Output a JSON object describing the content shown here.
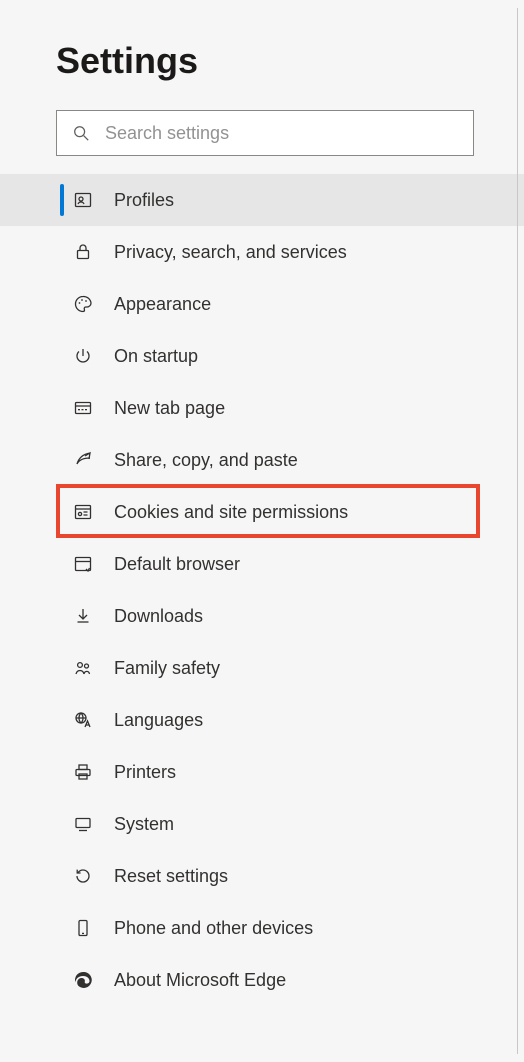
{
  "page_title": "Settings",
  "search": {
    "placeholder": "Search settings"
  },
  "nav": {
    "items": [
      {
        "id": "profiles",
        "label": "Profiles",
        "icon": "profile-card-icon",
        "selected": true
      },
      {
        "id": "privacy",
        "label": "Privacy, search, and services",
        "icon": "lock-icon",
        "selected": false
      },
      {
        "id": "appearance",
        "label": "Appearance",
        "icon": "palette-icon",
        "selected": false
      },
      {
        "id": "startup",
        "label": "On startup",
        "icon": "power-icon",
        "selected": false
      },
      {
        "id": "newtab",
        "label": "New tab page",
        "icon": "new-tab-icon",
        "selected": false
      },
      {
        "id": "share",
        "label": "Share, copy, and paste",
        "icon": "share-icon",
        "selected": false
      },
      {
        "id": "cookies",
        "label": "Cookies and site permissions",
        "icon": "site-permissions-icon",
        "selected": false,
        "highlighted": true
      },
      {
        "id": "default",
        "label": "Default browser",
        "icon": "browser-icon",
        "selected": false
      },
      {
        "id": "downloads",
        "label": "Downloads",
        "icon": "download-icon",
        "selected": false
      },
      {
        "id": "family",
        "label": "Family safety",
        "icon": "family-icon",
        "selected": false
      },
      {
        "id": "languages",
        "label": "Languages",
        "icon": "languages-icon",
        "selected": false
      },
      {
        "id": "printers",
        "label": "Printers",
        "icon": "printer-icon",
        "selected": false
      },
      {
        "id": "system",
        "label": "System",
        "icon": "system-icon",
        "selected": false
      },
      {
        "id": "reset",
        "label": "Reset settings",
        "icon": "reset-icon",
        "selected": false
      },
      {
        "id": "phone",
        "label": "Phone and other devices",
        "icon": "phone-icon",
        "selected": false
      },
      {
        "id": "about",
        "label": "About Microsoft Edge",
        "icon": "edge-icon",
        "selected": false
      }
    ]
  },
  "highlight": {
    "color": "#e8462f"
  }
}
